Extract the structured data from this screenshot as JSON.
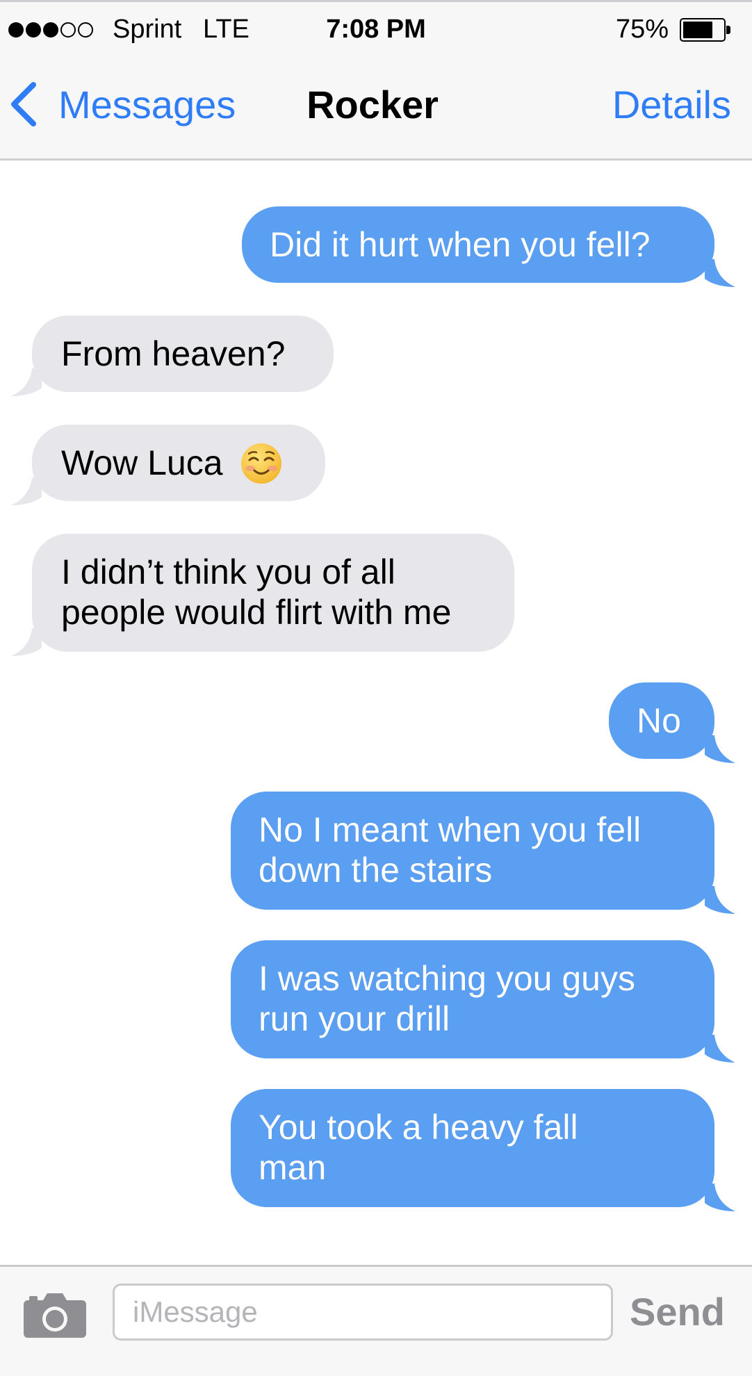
{
  "status_bar": {
    "signal_icon": "signal-dots-icon",
    "signal_filled": 3,
    "signal_total": 5,
    "carrier": "Sprint",
    "network": "LTE",
    "time": "7:08 PM",
    "battery_label": "75%",
    "battery_level": 0.75
  },
  "nav": {
    "back_icon": "chevron-left-icon",
    "back_label": "Messages",
    "title": "Rocker",
    "details_label": "Details"
  },
  "messages": [
    {
      "direction": "outgoing",
      "text": "Did it hurt when you fell?"
    },
    {
      "direction": "incoming",
      "text": "From heaven?"
    },
    {
      "direction": "incoming",
      "text": "Wow Luca",
      "emoji": "smiling-face-icon"
    },
    {
      "direction": "incoming",
      "text": "I didn’t think you of all\npeople would flirt with me"
    },
    {
      "direction": "outgoing",
      "text": "No"
    },
    {
      "direction": "outgoing",
      "text": "No I meant when you fell\ndown the stairs"
    },
    {
      "direction": "outgoing",
      "text": "I was watching you guys\nrun your drill"
    },
    {
      "direction": "outgoing",
      "text": "You took a heavy fall\nman"
    }
  ],
  "input_bar": {
    "camera_icon": "camera-icon",
    "placeholder": "iMessage",
    "value": "",
    "send_label": "Send"
  },
  "colors": {
    "accent_blue": "#2f7df6",
    "outgoing_bubble": "#5a9ff2",
    "incoming_bubble": "#e6e6eb",
    "send_disabled": "#8e8e93"
  }
}
